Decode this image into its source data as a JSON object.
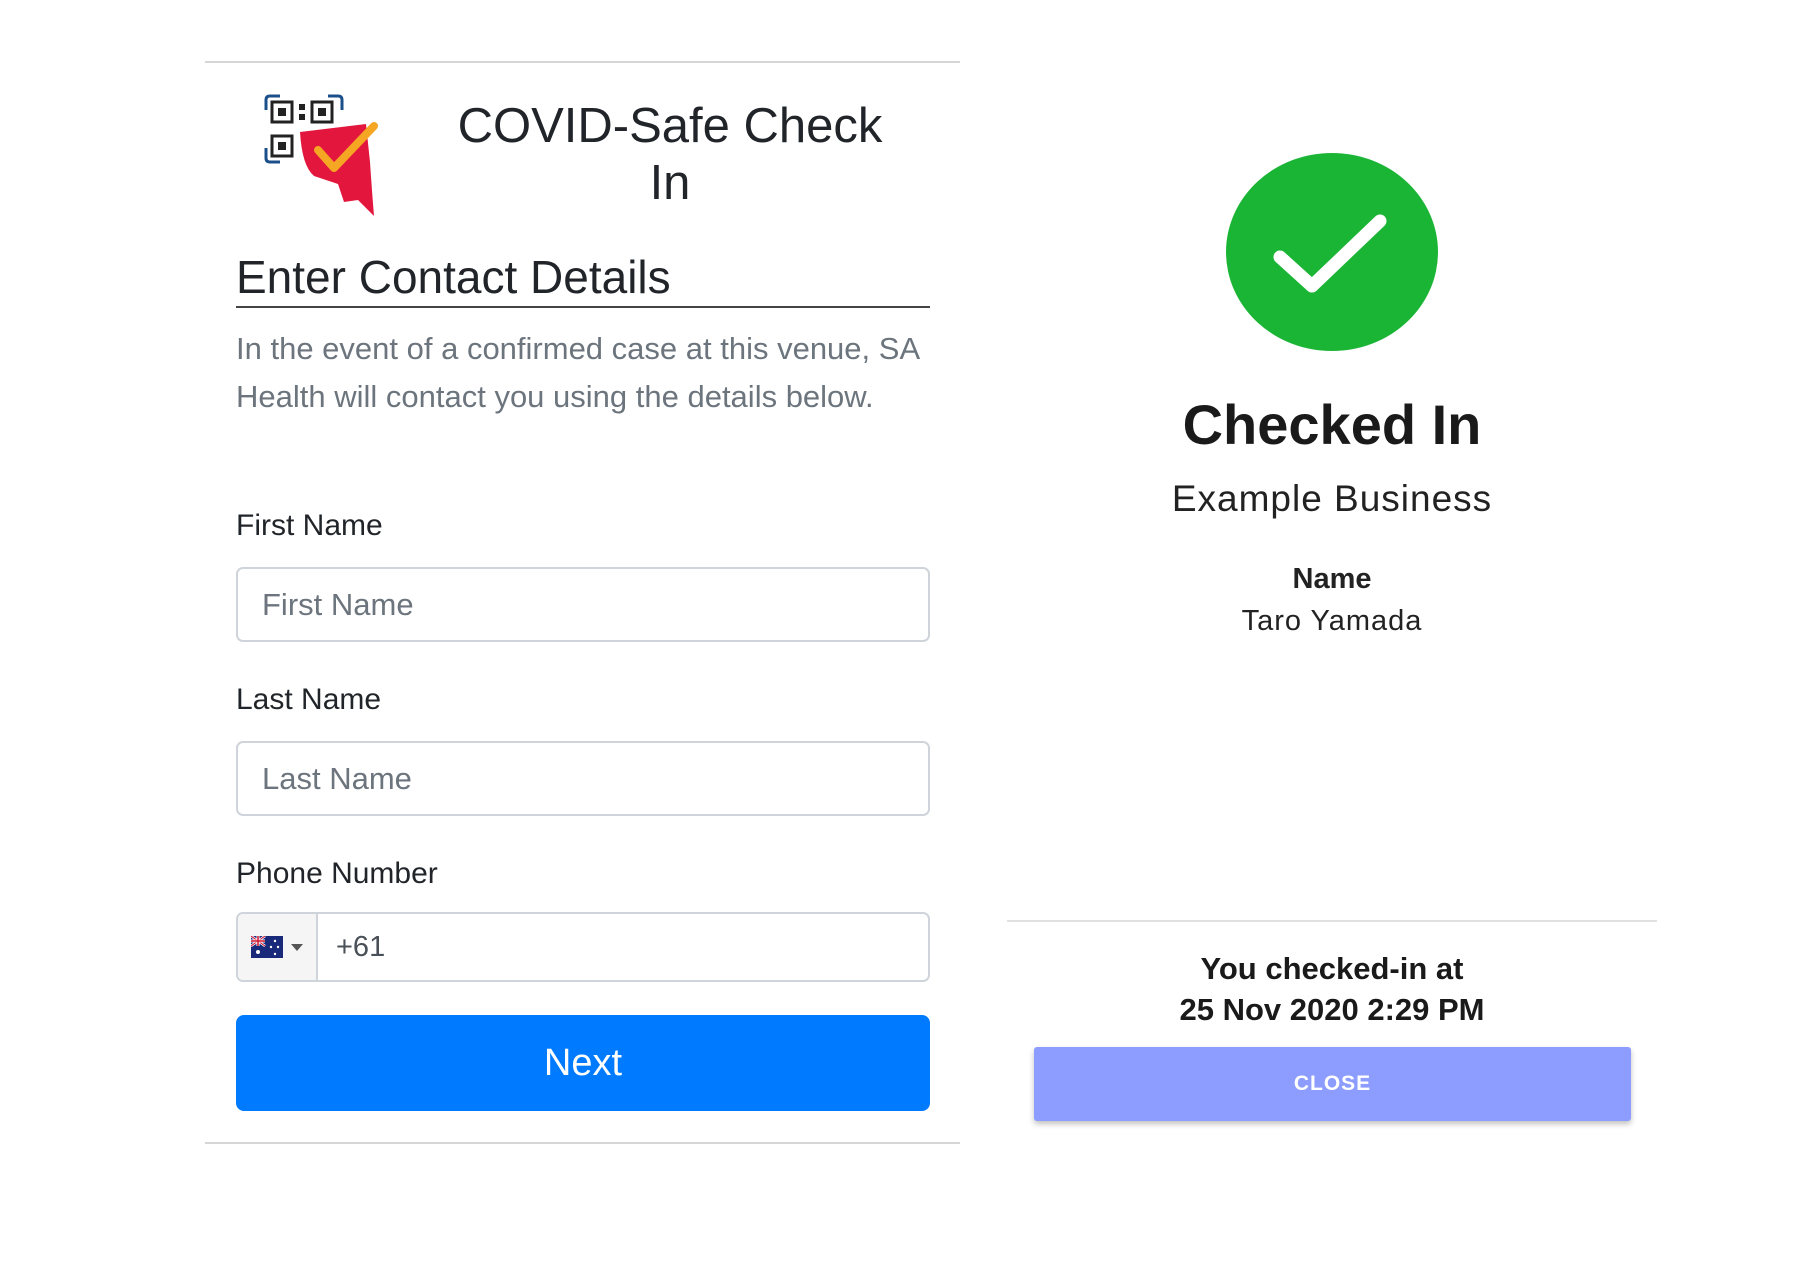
{
  "colors": {
    "primary_button": "#007bff",
    "close_button": "#8c9cff",
    "success_green": "#1bb536",
    "logo_red": "#e3173e",
    "logo_check": "#f5a623",
    "muted_text": "#6c757d"
  },
  "left": {
    "logo_icon": "qr-checkin-logo-icon",
    "title": "COVID-Safe Check In",
    "section_heading": "Enter Contact Details",
    "intro_text": "In the event of a confirmed case at this venue, SA Health will contact you using the details below.",
    "first_name": {
      "label": "First Name",
      "placeholder": "First Name",
      "value": ""
    },
    "last_name": {
      "label": "Last Name",
      "placeholder": "Last Name",
      "value": ""
    },
    "phone": {
      "label": "Phone Number",
      "country_flag_icon": "australia-flag-icon",
      "value": "+61"
    },
    "next_label": "Next"
  },
  "right": {
    "status_icon": "check-circle-icon",
    "title": "Checked In",
    "business_name": "Example Business",
    "name_label": "Name",
    "name_value": "Taro Yamada",
    "checkin_line1": "You checked-in at",
    "checkin_line2": "25 Nov 2020 2:29 PM",
    "close_label": "CLOSE"
  }
}
